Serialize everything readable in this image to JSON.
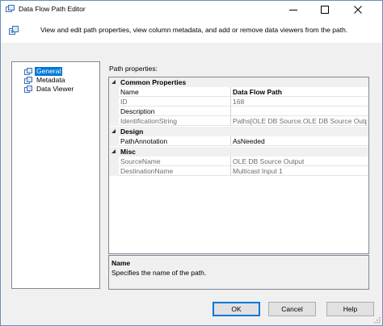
{
  "window": {
    "title": "Data Flow Path Editor",
    "buttons": {
      "minimize": "—",
      "maximize": "☐",
      "close": "✕"
    }
  },
  "header": {
    "description": "View and edit path properties, view column metadata, and add or remove data viewers from the path."
  },
  "nav": {
    "items": [
      {
        "label": "General",
        "selected": true
      },
      {
        "label": "Metadata",
        "selected": false
      },
      {
        "label": "Data Viewer",
        "selected": false
      }
    ]
  },
  "properties": {
    "title": "Path properties:",
    "categories": [
      {
        "name": "Common Properties",
        "rows": [
          {
            "name": "Name",
            "value": "Data Flow Path"
          },
          {
            "name": "ID",
            "value": "168"
          },
          {
            "name": "Description",
            "value": ""
          },
          {
            "name": "IdentificationString",
            "value": "Paths[OLE DB Source.OLE DB Source Output]"
          }
        ]
      },
      {
        "name": "Design",
        "rows": [
          {
            "name": "PathAnnotation",
            "value": "AsNeeded"
          }
        ]
      },
      {
        "name": "Misc",
        "rows": [
          {
            "name": "SourceName",
            "value": "OLE DB Source Output"
          },
          {
            "name": "DestinationName",
            "value": "Multicast Input 1"
          }
        ]
      }
    ]
  },
  "description_pane": {
    "name": "Name",
    "text": "Specifies the name of the path."
  },
  "footer": {
    "ok": "OK",
    "cancel": "Cancel",
    "help": "Help"
  },
  "colors": {
    "selection": "#0078d7",
    "readonly_text": "#6d6d6d",
    "category_bg": "#f0f0f0"
  }
}
